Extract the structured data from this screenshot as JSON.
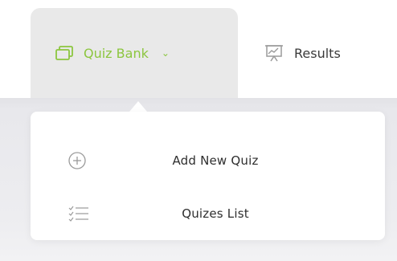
{
  "nav": {
    "items": [
      {
        "label": "Quiz Bank",
        "icon": "monitor-icon",
        "active": true,
        "has_dropdown": true
      },
      {
        "label": "Results",
        "icon": "presentation-chart-icon",
        "active": false,
        "has_dropdown": false
      }
    ],
    "chevron": "⌄"
  },
  "dropdown": {
    "items": [
      {
        "label": "Add New Quiz",
        "icon": "plus-circle-icon"
      },
      {
        "label": "Quizes List",
        "icon": "checklist-icon"
      }
    ]
  },
  "colors": {
    "accent": "#8cc63f",
    "tab_active_bg": "#e9e9e9",
    "text": "#2e2e2e",
    "icon_gray": "#9a9a9a"
  }
}
